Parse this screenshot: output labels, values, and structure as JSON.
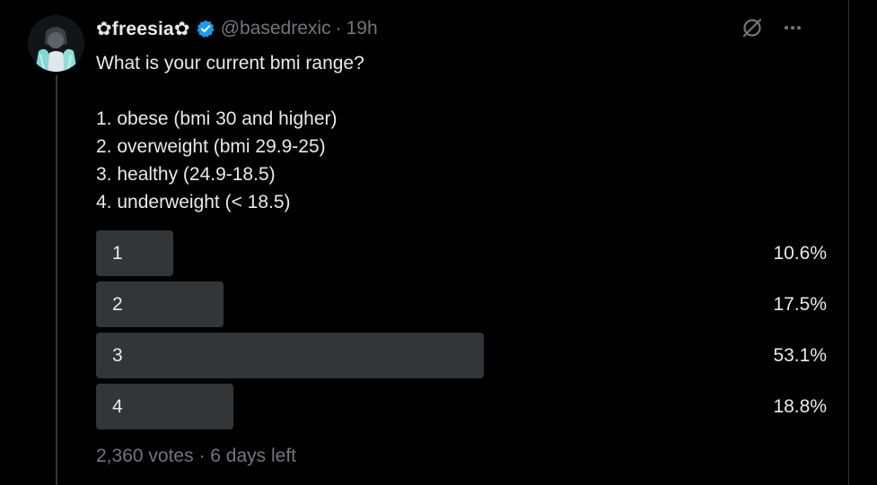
{
  "tweet": {
    "display_name": "✿freesia✿",
    "handle": "@basedrexic",
    "separator": "·",
    "time": "19h",
    "text_question": "What is your current bmi range?",
    "text_options": [
      "1. obese (bmi 30 and higher)",
      "2. overweight (bmi 29.9-25)",
      "3. healthy (24.9-18.5)",
      "4. underweight (< 18.5)"
    ]
  },
  "poll": {
    "options": [
      {
        "label": "1",
        "percent_text": "10.6%",
        "percent": 10.6
      },
      {
        "label": "2",
        "percent_text": "17.5%",
        "percent": 17.5
      },
      {
        "label": "3",
        "percent_text": "53.1%",
        "percent": 53.1
      },
      {
        "label": "4",
        "percent_text": "18.8%",
        "percent": 18.8
      }
    ],
    "votes": "2,360 votes",
    "separator": "·",
    "time_left": "6 days left"
  },
  "colors": {
    "background": "#000000",
    "text": "#e7e9ea",
    "muted": "#71767b",
    "bar": "#333639",
    "verified": "#1d9bf0"
  },
  "icons": {
    "grok": "grok-icon",
    "more": "more-icon",
    "verified": "verified-badge-icon"
  }
}
